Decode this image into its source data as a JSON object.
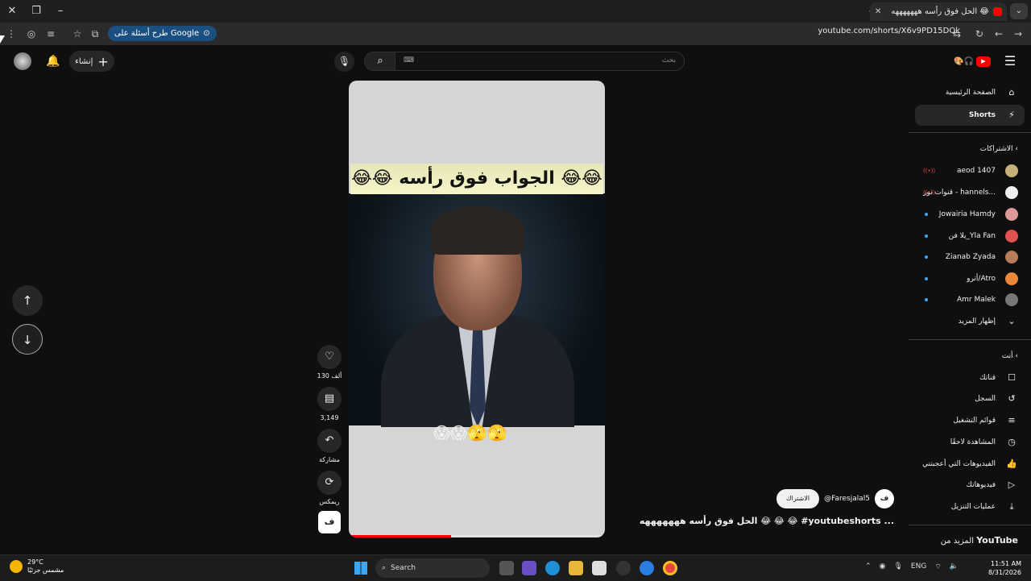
{
  "browser": {
    "tab_title": "الحل فوق رأسه هههههههه 😂",
    "url": "youtube.com/shorts/X6v9PD15DQk",
    "ask_google": "طرح أسئلة على Google"
  },
  "youtube": {
    "search_placeholder": "بحث",
    "create_label": "إنشاء",
    "sidebar": {
      "home": "الصفحة الرئيسية",
      "shorts": "Shorts",
      "subscriptions_header": "الاشتراكات",
      "subscriptions": [
        {
          "name": "aeod 1407",
          "live": true
        },
        {
          "name": "قنوات نور - hannels...",
          "live": true
        },
        {
          "name": "Jowairia Hamdy",
          "live": false
        },
        {
          "name": "يلا فن_Yla Fan",
          "live": false
        },
        {
          "name": "Zianab Zyada",
          "live": false
        },
        {
          "name": "أترو/Atro",
          "live": false
        },
        {
          "name": "Amr Malek",
          "live": false
        }
      ],
      "show_more": "إظهار المزيد",
      "you_header": "أنت",
      "you_items": [
        "قناتك",
        "السجل",
        "قوائم التشغيل",
        "المشاهدة لاحقًا",
        "الفيديوهات التي أعجبتني",
        "فيديوهاتك",
        "عمليات التنزيل"
      ],
      "more_from": "المزيد من",
      "more_from_brand": "YouTube"
    },
    "short": {
      "caption": "😂😂 الجواب فوق رأسه 😂😂",
      "emojis": "😱😱🫣🫣",
      "like_count": "130 ألف",
      "comment_count": "3,149",
      "share_label": "مشاركة",
      "remix_label": "ريمكس",
      "channel_handle": "@Faresjalal5",
      "subscribe_label": "الاشتراك",
      "title": "الحل فوق رأسه هههههههه 😂 😂 😂 #youtubeshorts ...",
      "progress": 0.4
    }
  },
  "taskbar": {
    "temp": "29°C",
    "weather_desc": "مشمس جزئيًا",
    "search": "Search",
    "lang": "ENG",
    "time": "11:51 AM",
    "date": "8/31/2026"
  },
  "colors": {
    "accent_red": "#ff0000",
    "blue_dot": "#3ea6ff",
    "background": "#0f0f0f"
  }
}
